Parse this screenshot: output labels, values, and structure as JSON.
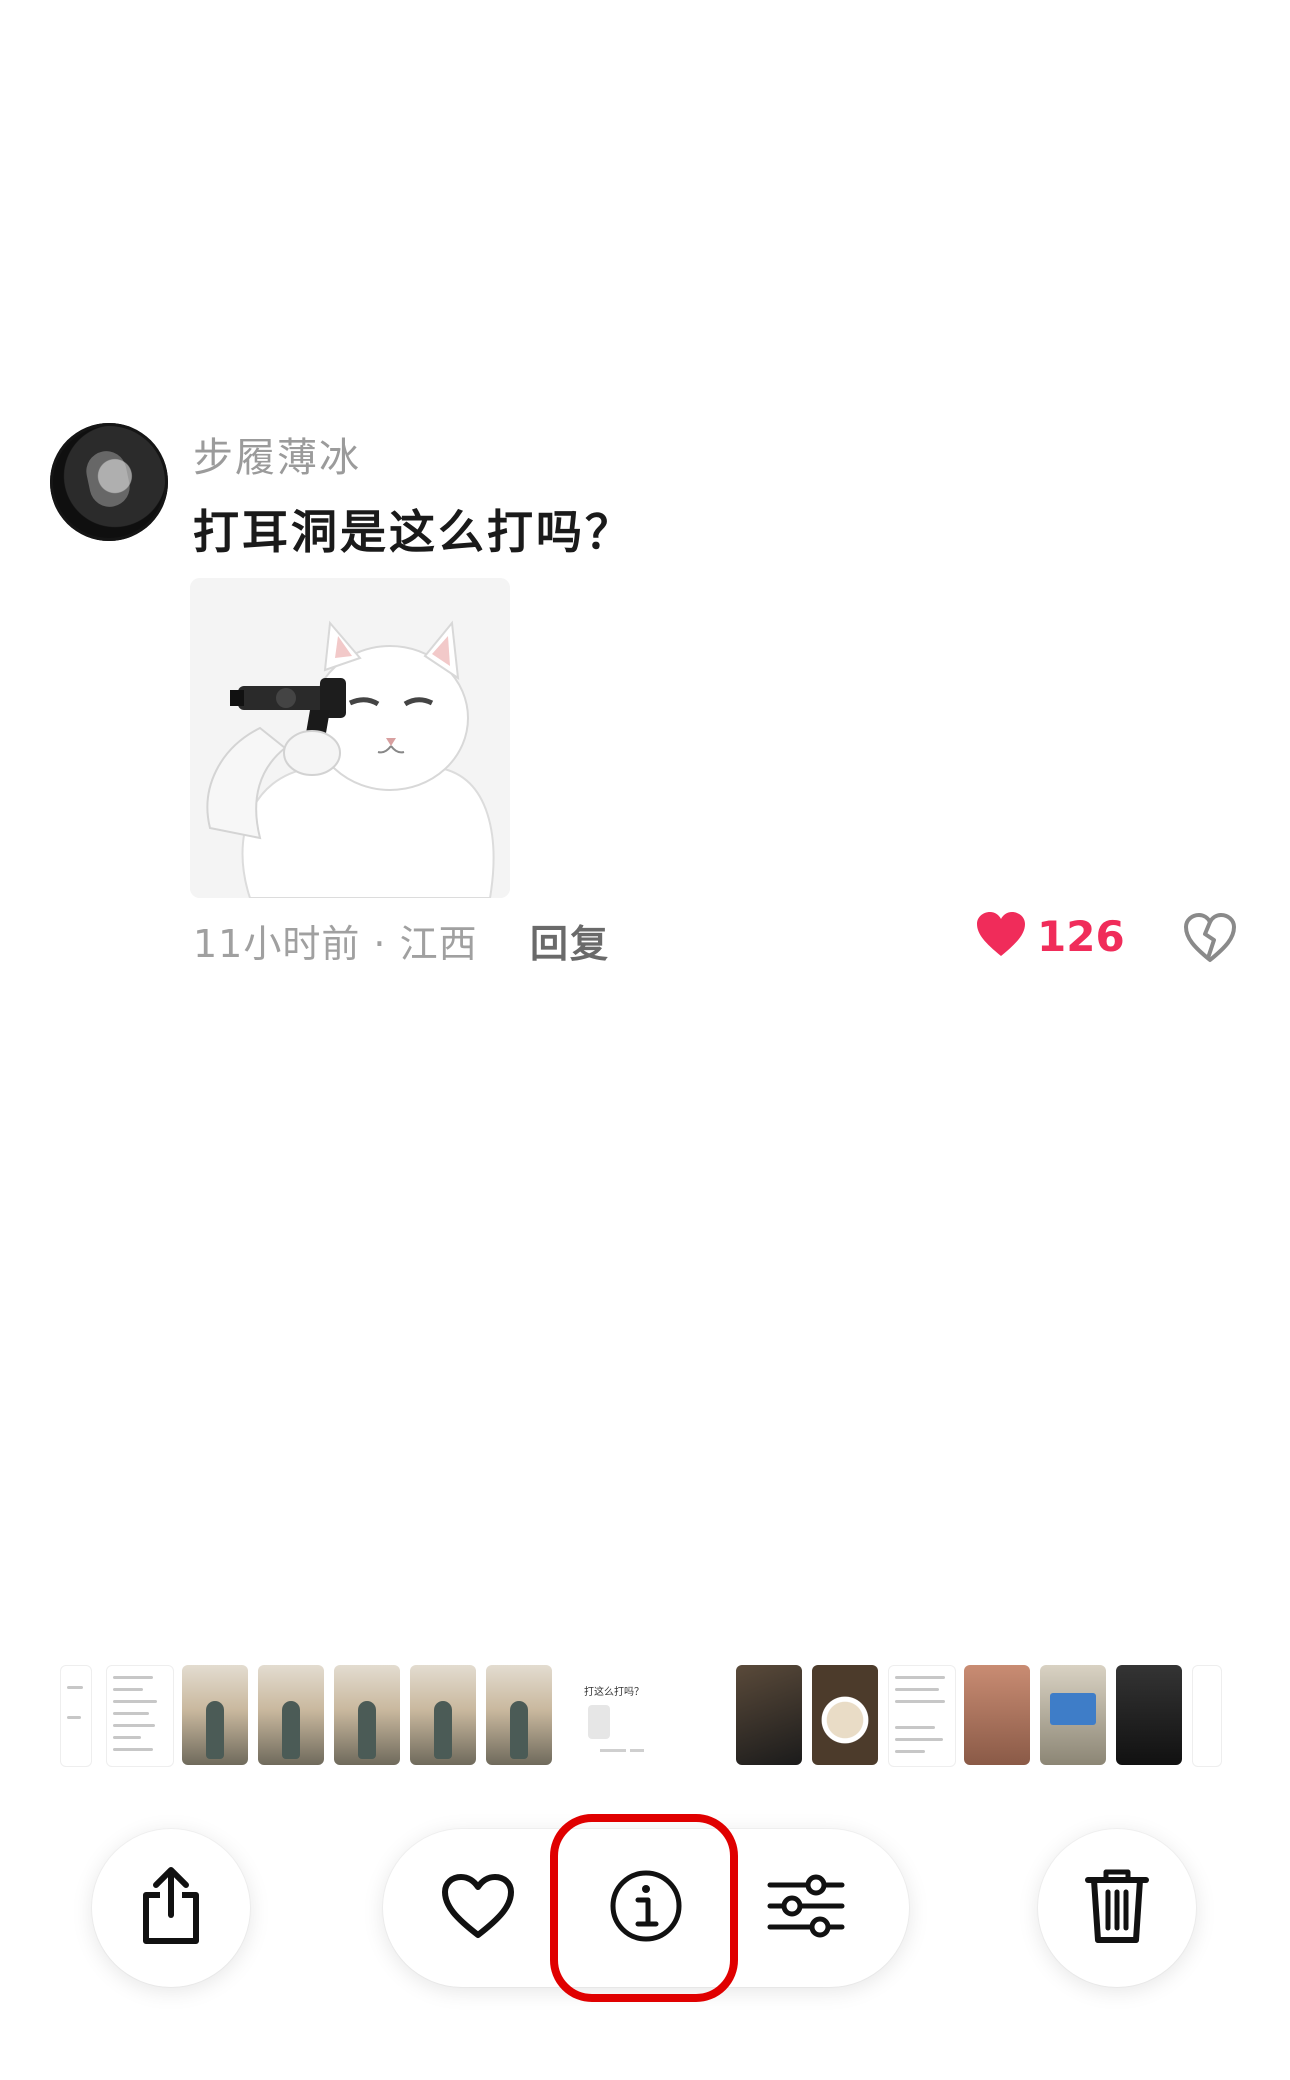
{
  "comment": {
    "username": "步履薄冰",
    "text": "打耳洞是这么打吗？",
    "meta": "11小时前 · 江西",
    "reply_label": "回复",
    "like_count": "126",
    "sticker": "cat-with-gun-sticker"
  },
  "thumbnail_strip": {
    "current_preview_text": "打这么打吗？"
  },
  "toolbar": {
    "share_icon": "share-icon",
    "favorite_icon": "heart-outline-icon",
    "info_icon": "info-icon",
    "adjust_icon": "sliders-icon",
    "delete_icon": "trash-icon"
  },
  "colors": {
    "like_red": "#f02c5a",
    "highlight_red": "#e00000",
    "username_gray": "#9b9b9b"
  }
}
